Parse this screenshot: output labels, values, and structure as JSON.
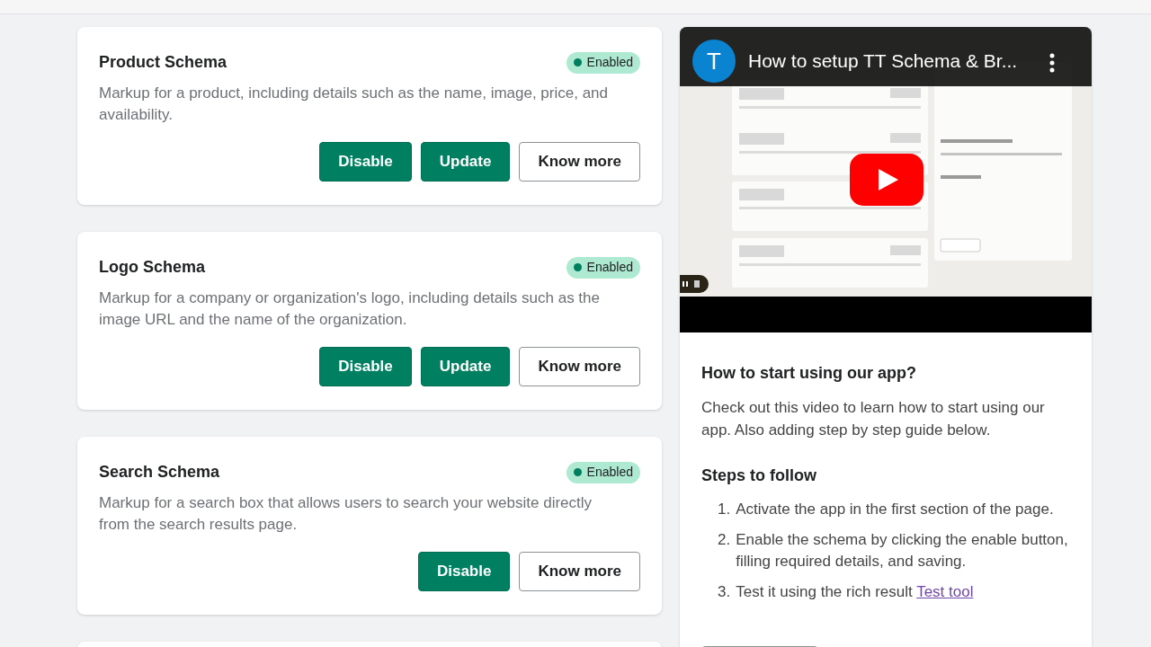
{
  "schemas": [
    {
      "title": "Product Schema",
      "status": "Enabled",
      "enabled": true,
      "description": "Markup for a product, including details such as the name, image, price, and availability.",
      "buttons": [
        {
          "label": "Disable",
          "kind": "primary"
        },
        {
          "label": "Update",
          "kind": "primary"
        },
        {
          "label": "Know more",
          "kind": "outline"
        }
      ]
    },
    {
      "title": "Logo Schema",
      "status": "Enabled",
      "enabled": true,
      "description": "Markup for a company or organization's logo, including details such as the image URL and the name of the organization.",
      "buttons": [
        {
          "label": "Disable",
          "kind": "primary"
        },
        {
          "label": "Update",
          "kind": "primary"
        },
        {
          "label": "Know more",
          "kind": "outline"
        }
      ]
    },
    {
      "title": "Search Schema",
      "status": "Enabled",
      "enabled": true,
      "description": "Markup for a search box that allows users to search your website directly from the search results page.",
      "buttons": [
        {
          "label": "Disable",
          "kind": "primary"
        },
        {
          "label": "Know more",
          "kind": "outline"
        }
      ]
    }
  ],
  "video": {
    "channel_initial": "T",
    "title": "How to setup TT Schema & Br..."
  },
  "guide": {
    "heading": "How to start using our app?",
    "intro": "Check out this video to learn how to start using our app. Also adding step by step guide below.",
    "steps_heading": "Steps to follow",
    "steps": [
      {
        "number": "1.",
        "text": "Activate the app in the first section of the page."
      },
      {
        "number": "2.",
        "text": "Enable the schema by clicking the enable button, filling required details, and saving."
      },
      {
        "number": "3.",
        "text": "Test it using the rich result",
        "link": "Test tool"
      }
    ]
  }
}
